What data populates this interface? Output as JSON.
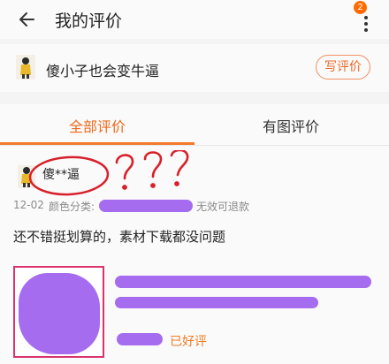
{
  "header": {
    "title": "我的评价",
    "notification_count": "2",
    "back_icon": "arrow-left-icon",
    "more_icon": "more-vertical-icon"
  },
  "product": {
    "name": "傻小子也会变牛逼",
    "write_review_label": "写评价"
  },
  "tabs": [
    {
      "label": "全部评价",
      "active": true
    },
    {
      "label": "有图评价",
      "active": false
    }
  ],
  "review": {
    "username": "傻**逼",
    "date": "12-02",
    "color_category_label": "颜色分类:",
    "note": "无效可退款",
    "text": "还不错挺划算的，素材下载都没问题",
    "status": "已好评"
  },
  "colors": {
    "accent": "#ee6a1e",
    "scribble": "#a56cf0",
    "annotation_red": "#d8202a"
  }
}
